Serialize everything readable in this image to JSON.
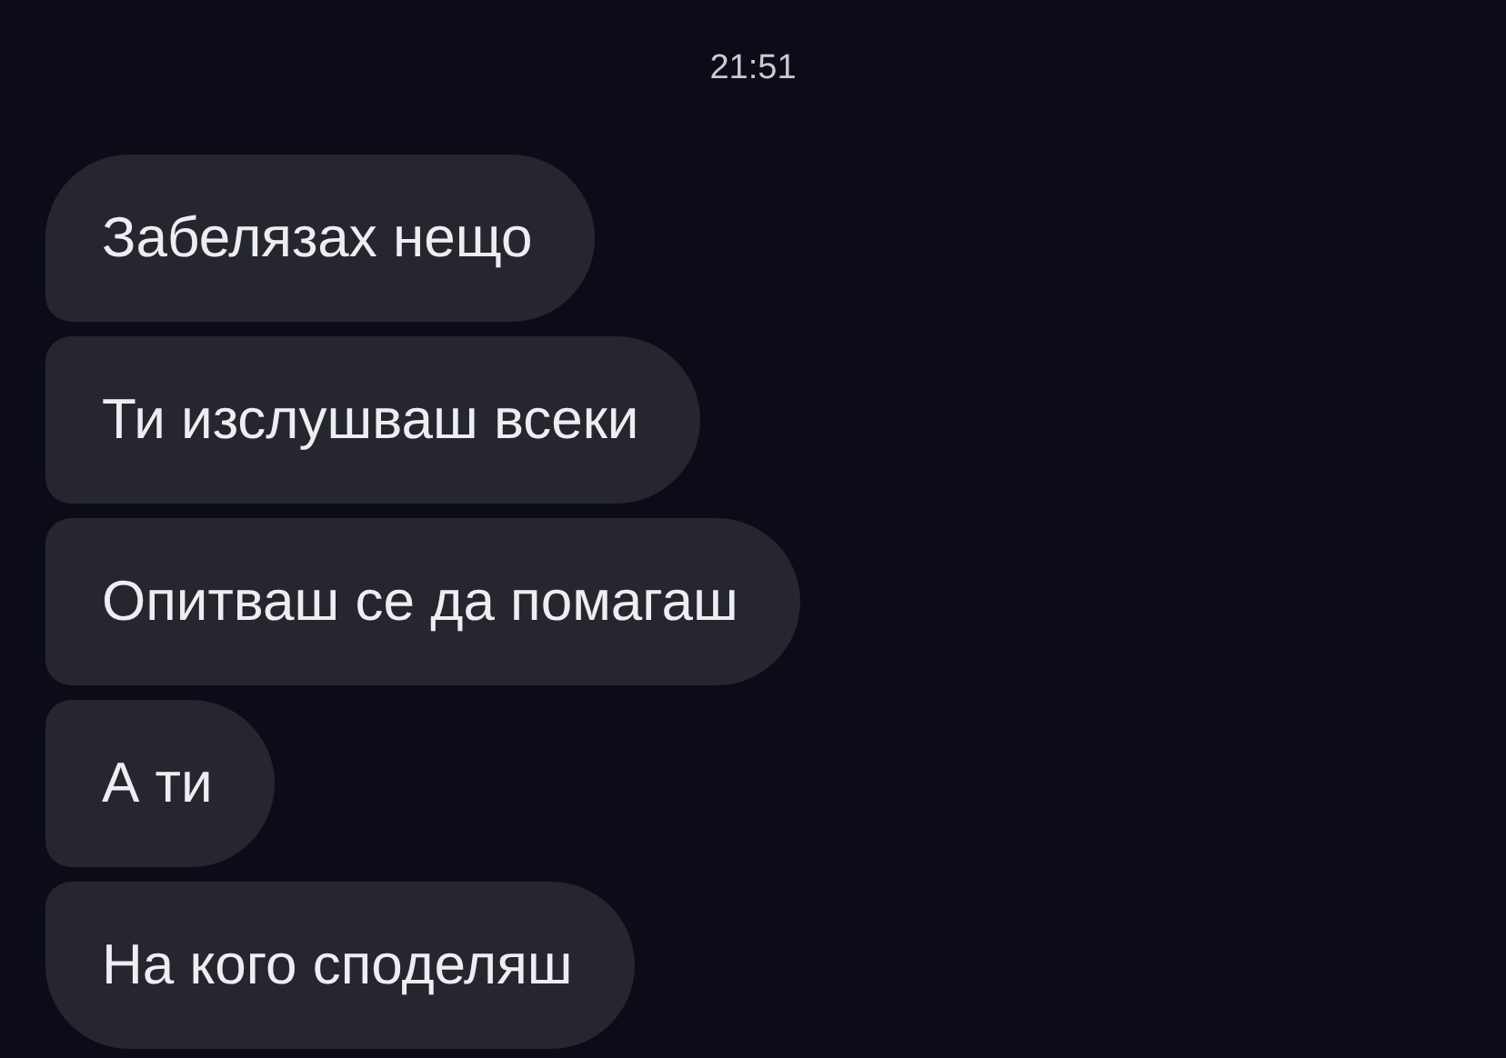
{
  "timestamp": "21:51",
  "messages": [
    {
      "text": "Забелязах нещо"
    },
    {
      "text": "Ти изслушваш всеки"
    },
    {
      "text": "Опитваш се да помагаш"
    },
    {
      "text": "А ти"
    },
    {
      "text": "На кого споделяш"
    }
  ]
}
